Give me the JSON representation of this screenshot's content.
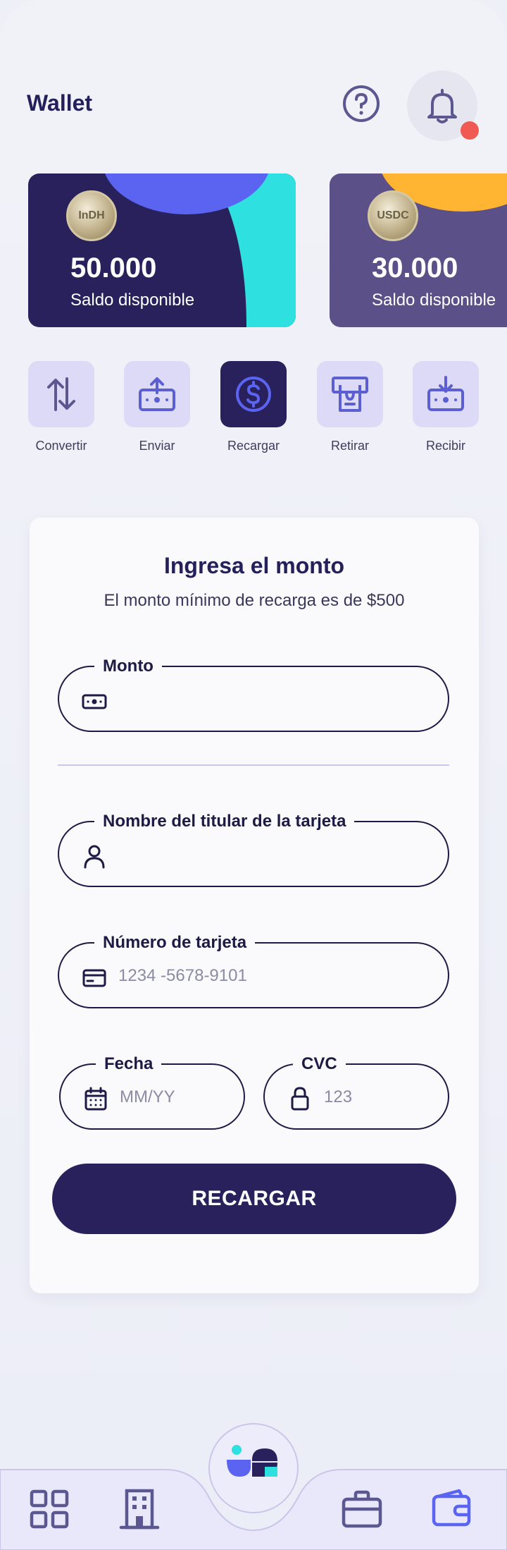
{
  "header": {
    "title": "Wallet",
    "help_icon": "question-circle-icon",
    "notifications_icon": "bell-icon"
  },
  "cards": [
    {
      "coin": "InDH",
      "amount": "50.000",
      "label": "Saldo disponible"
    },
    {
      "coin": "USDC",
      "amount": "30.000",
      "label": "Saldo disponible"
    }
  ],
  "actions": [
    {
      "label": "Convertir",
      "icon": "swap-arrows-icon",
      "active": false
    },
    {
      "label": "Enviar",
      "icon": "send-money-icon",
      "active": false
    },
    {
      "label": "Recargar",
      "icon": "dollar-circle-icon",
      "active": true
    },
    {
      "label": "Retirar",
      "icon": "atm-withdraw-icon",
      "active": false
    },
    {
      "label": "Recibir",
      "icon": "receive-money-icon",
      "active": false
    }
  ],
  "form": {
    "title": "Ingresa el monto",
    "subtitle": "El monto mínimo de recarga es de $500",
    "amount": {
      "label": "Monto",
      "value": "",
      "placeholder": ""
    },
    "holder": {
      "label": "Nombre del titular de la tarjeta",
      "value": "",
      "placeholder": ""
    },
    "card_number": {
      "label": "Número de tarjeta",
      "value": "",
      "placeholder": "1234 -5678-9101"
    },
    "date": {
      "label": "Fecha",
      "value": "",
      "placeholder": "MM/YY"
    },
    "cvc": {
      "label": "CVC",
      "value": "",
      "placeholder": "123"
    },
    "submit_label": "RECARGAR"
  },
  "bottom_nav": [
    "grid-icon",
    "building-icon",
    "app-logo-icon",
    "briefcase-icon",
    "wallet-icon"
  ],
  "colors": {
    "primary": "#29215c",
    "accent_blue": "#5b64f0",
    "accent_cyan": "#2ee0e0",
    "accent_yellow": "#ffb531",
    "tile_bg": "#dcdaf6",
    "notification_dot": "#ef5a52"
  }
}
